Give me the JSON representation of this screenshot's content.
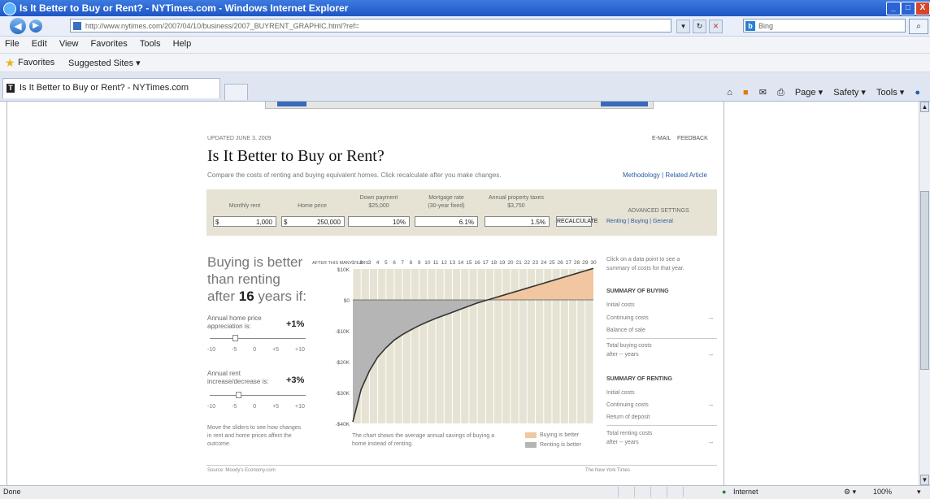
{
  "window": {
    "title": "Is It Better to Buy or Rent? - NYTimes.com - Windows Internet Explorer",
    "buttons": [
      "_",
      "□",
      "X"
    ]
  },
  "nav": {
    "address": "http://www.nytimes.com/2007/04/10/business/2007_BUYRENT_GRAPHIC.html?ref=",
    "search_placeholder": "Bing",
    "back_glyph": "◀",
    "forward_glyph": "▶",
    "icons": [
      "go-icon",
      "refresh-icon",
      "stop-icon"
    ]
  },
  "menu": [
    "File",
    "Edit",
    "View",
    "Favorites",
    "Tools",
    "Help"
  ],
  "favorites": {
    "label": "Favorites",
    "suggested": "Suggested Sites ▾"
  },
  "tab": {
    "label": "Is It Better to Buy or Rent? - NYTimes.com"
  },
  "commandbar": [
    "Page ▾",
    "Safety ▾",
    "Tools ▾"
  ],
  "page": {
    "updated": "UPDATED JUNE 3, 2009",
    "email": "E-MAIL",
    "feedback": "FEEDBACK",
    "headline": "Is It Better to Buy or Rent?",
    "intro": "Compare the costs of renting and buying equivalent homes. Click recalculate after you make changes.",
    "methodology": "Methodology | Related Article",
    "inputs": {
      "monthly_rent": {
        "label": "Monthly rent",
        "prefix": "$",
        "value": "1,000"
      },
      "home_price": {
        "label": "Home price",
        "prefix": "$",
        "value": "250,000"
      },
      "down_payment": {
        "label": "Down payment",
        "sub": "$25,000",
        "value": "10%"
      },
      "mortgage_rate": {
        "label": "Mortgage rate",
        "sub": "(30-year fixed)",
        "value": "6.1%"
      },
      "property_taxes": {
        "label": "Annual property taxes",
        "sub": "$3,750",
        "value": "1.5%"
      },
      "recalculate": "RECALCULATE",
      "advanced": "ADVANCED SETTINGS",
      "advanced_links": "Renting | Buying | General"
    },
    "verdict": {
      "line1": "Buying is better",
      "line2": "than renting",
      "line3_pre": "after",
      "years": "16",
      "line3_post": "years if:"
    },
    "control1": {
      "label1": "Annual home price",
      "label2": "appreciation is:",
      "value": "+1%",
      "ticks": "-10 -5 0 +5 +10"
    },
    "control2": {
      "label1": "Annual rent",
      "label2": "increase/decrease is:",
      "value": "+3%",
      "ticks": "-10 -5 0 +5 +10"
    },
    "note": "Move the sliders to see how changes in rent and home prices affect the outcome.",
    "right": {
      "hint1": "Click on a data point to see a",
      "hint2": "summary of costs for that year.",
      "sum_buy": "SUMMARY OF BUYING",
      "buy_rows": [
        "Initial costs",
        "Continuing costs",
        "Balance of sale"
      ],
      "buy_total": [
        "Total buying costs",
        "after -- years"
      ],
      "sum_rent": "SUMMARY OF RENTING",
      "rent_rows": [
        "Initial costs",
        "Continuing costs",
        "Return of deposit"
      ],
      "rent_total": [
        "Total renting costs",
        "after -- years"
      ],
      "dash": "--"
    },
    "bottom_note": "The chart shows the average annual savings of buying a home instead of renting.",
    "legend_buy": "Buying is better",
    "legend_rent": "Renting is better",
    "footer_left": "Source: Moody's Economy.com",
    "footer_right": "The New York Times"
  },
  "chart_data": {
    "type": "area",
    "x_label": "AFTER THIS MANY YEARS",
    "x_ticks": [
      "1",
      "2",
      "3",
      "4",
      "5",
      "6",
      "7",
      "8",
      "9",
      "10",
      "11",
      "12",
      "13",
      "14",
      "15",
      "16",
      "17",
      "18",
      "19",
      "20",
      "21",
      "22",
      "23",
      "24",
      "25",
      "26",
      "27",
      "28",
      "29",
      "30"
    ],
    "y_ticks": [
      "$10K",
      "$0",
      "-$10K",
      "-$20K",
      "-$30K",
      "-$40K"
    ],
    "ylim": [
      -40000,
      10000
    ],
    "x": [
      1,
      2,
      3,
      4,
      5,
      6,
      7,
      8,
      9,
      10,
      11,
      12,
      13,
      14,
      15,
      16,
      17,
      18,
      19,
      20,
      21,
      22,
      23,
      24,
      25,
      26,
      27,
      28,
      29,
      30
    ],
    "values": [
      -39500,
      -29000,
      -23000,
      -18500,
      -15500,
      -13000,
      -11200,
      -9700,
      -8300,
      -7100,
      -6000,
      -5000,
      -4000,
      -3000,
      -2000,
      -1000,
      -200,
      600,
      1400,
      2200,
      3000,
      3800,
      4600,
      5400,
      6200,
      7000,
      7800,
      8600,
      9400,
      10200
    ],
    "colors": {
      "buy": "#f0c7a0",
      "rent": "#b5b5b5",
      "bg": "#e6e3d4",
      "line": "#333333"
    }
  },
  "status": {
    "left": "Done",
    "zone": "Internet",
    "zoom": "100%"
  }
}
